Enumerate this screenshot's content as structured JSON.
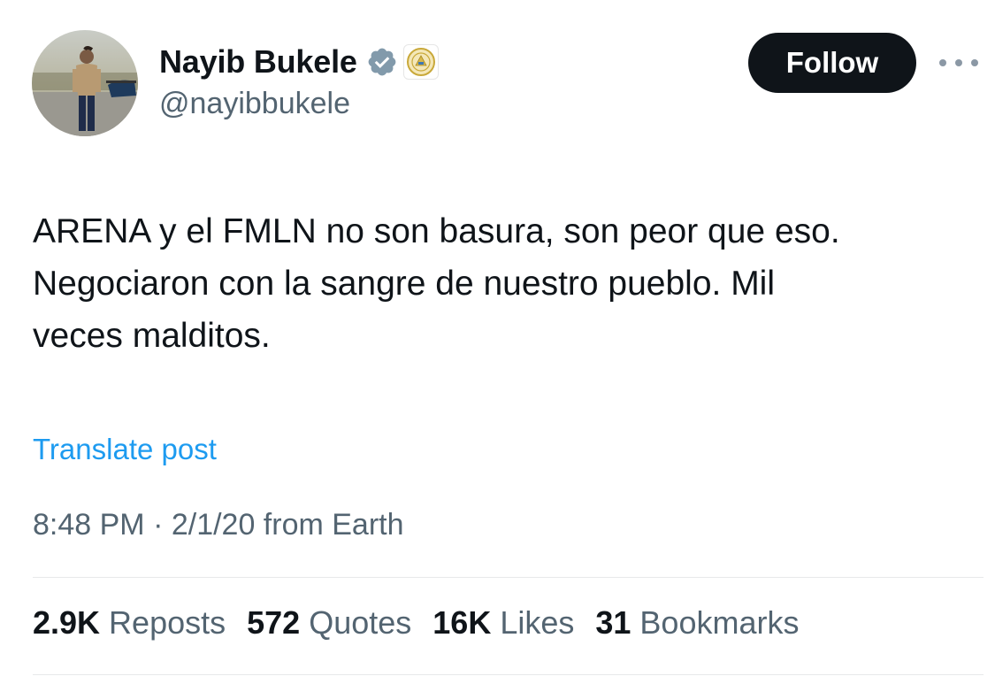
{
  "author": {
    "display_name": "Nayib Bukele",
    "handle": "@nayibbukele"
  },
  "follow_label": "Follow",
  "tweet": {
    "lines": [
      "ARENA y el FMLN no son basura, son peor que eso.",
      "Negociaron con la sangre de nuestro pueblo. Mil",
      "veces malditos."
    ]
  },
  "translate_label": "Translate post",
  "meta": "8:48 PM · 2/1/20 from Earth",
  "stats": [
    {
      "value": "2.9K",
      "label": "Reposts"
    },
    {
      "value": "572",
      "label": "Quotes"
    },
    {
      "value": "16K",
      "label": "Likes"
    },
    {
      "value": "31",
      "label": "Bookmarks"
    }
  ],
  "colors": {
    "text": "#0f1419",
    "secondary": "#536471",
    "link": "#1d9bf0",
    "verified": "#829aab",
    "button_bg": "#0f1419"
  },
  "icons": {
    "verified": "verified-badge-icon",
    "affiliate": "government-seal-icon",
    "more": "more-horizontal-icon"
  }
}
